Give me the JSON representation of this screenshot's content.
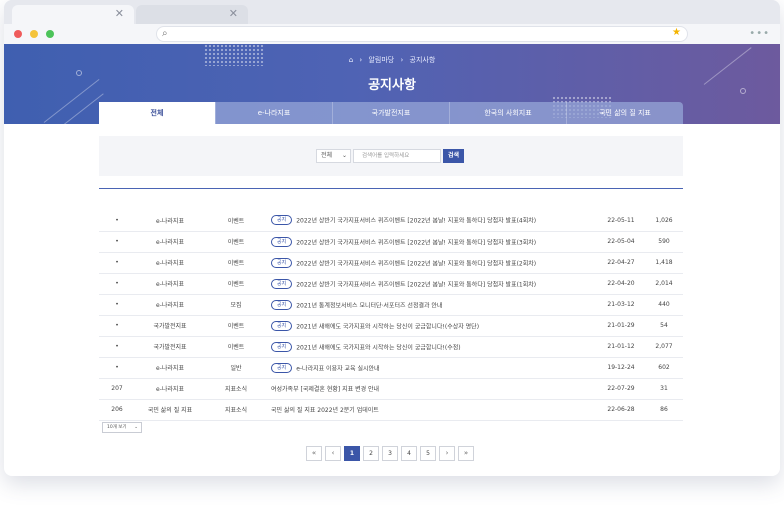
{
  "browser": {
    "tab_close_1": "✕",
    "tab_close_2": "✕",
    "menu": "•••"
  },
  "hero": {
    "breadcrumb": [
      "알림마당",
      "공지사항"
    ],
    "title": "공지사항"
  },
  "tabs": [
    {
      "label": "전체",
      "active": true
    },
    {
      "label": "e-나라지표",
      "active": false
    },
    {
      "label": "국가발전지표",
      "active": false
    },
    {
      "label": "한국의 사회지표",
      "active": false
    },
    {
      "label": "국민 삶의 질 지표",
      "active": false
    }
  ],
  "search": {
    "scope": "전체",
    "placeholder": "검색어를 입력하세요",
    "button": "검색"
  },
  "rows": [
    {
      "no": "•",
      "site": "e-나라지표",
      "category": "이벤트",
      "badge": "공지",
      "title": "2022년 상반기 국가지표서비스 퀴즈이벤트 [2022년 봄날! 지표와 통하다] 당첨자 발표(4회차)",
      "date": "22-05-11",
      "views": "1,026"
    },
    {
      "no": "•",
      "site": "e-나라지표",
      "category": "이벤트",
      "badge": "공지",
      "title": "2022년 상반기 국가지표서비스 퀴즈이벤트 [2022년 봄날! 지표와 통하다] 당첨자 발표(3회차)",
      "date": "22-05-04",
      "views": "590"
    },
    {
      "no": "•",
      "site": "e-나라지표",
      "category": "이벤트",
      "badge": "공지",
      "title": "2022년 상반기 국가지표서비스 퀴즈이벤트 [2022년 봄날! 지표와 통하다] 당첨자 발표(2회차)",
      "date": "22-04-27",
      "views": "1,418"
    },
    {
      "no": "•",
      "site": "e-나라지표",
      "category": "이벤트",
      "badge": "공지",
      "title": "2022년 상반기 국가지표서비스 퀴즈이벤트 [2022년 봄날! 지표와 통하다] 당첨자 발표(1회차)",
      "date": "22-04-20",
      "views": "2,014"
    },
    {
      "no": "•",
      "site": "e-나라지표",
      "category": "모집",
      "badge": "공지",
      "title": "2021년 통계정보서비스 모니터단·서포터즈 선정결과 안내",
      "date": "21-03-12",
      "views": "440"
    },
    {
      "no": "•",
      "site": "국가발전지표",
      "category": "이벤트",
      "badge": "공지",
      "title": "2021년 새해에도 국가지표와 시작하는 당신이 궁금합니다!(수상자 명단)",
      "date": "21-01-29",
      "views": "54"
    },
    {
      "no": "•",
      "site": "국가발전지표",
      "category": "이벤트",
      "badge": "공지",
      "title": "2021년 새해에도 국가지표와 시작하는 당신이 궁금합니다!(수정)",
      "date": "21-01-12",
      "views": "2,077"
    },
    {
      "no": "•",
      "site": "e-나라지표",
      "category": "일반",
      "badge": "공지",
      "title": "e-나라지표 이용자 교육 실시안내",
      "date": "19-12-24",
      "views": "602"
    },
    {
      "no": "207",
      "site": "e-나라지표",
      "category": "지표소식",
      "badge": "",
      "title": "여성가족부 [국제결혼 현황] 지표 변경 안내",
      "date": "22-07-29",
      "views": "31"
    },
    {
      "no": "206",
      "site": "국민 삶의 질 지표",
      "category": "지표소식",
      "badge": "",
      "title": "국민 삶의 질 지표 2022년 2분기 업데이트",
      "date": "22-06-28",
      "views": "86"
    }
  ],
  "page_size": "10개 보기",
  "pager": {
    "first": "«",
    "prev": "‹",
    "pages": [
      "1",
      "2",
      "3",
      "4",
      "5"
    ],
    "current": "1",
    "next": "›",
    "last": "»"
  }
}
